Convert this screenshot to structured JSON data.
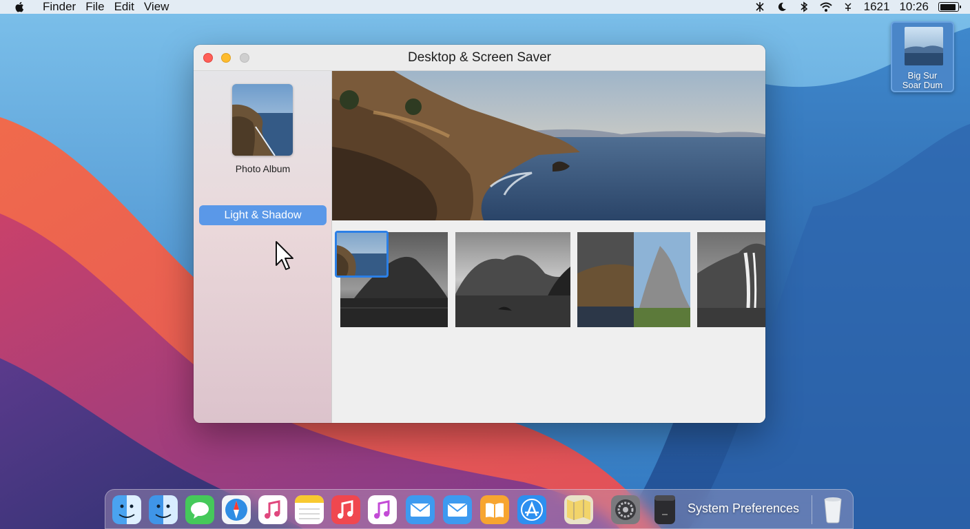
{
  "menubar": {
    "app_name": "Finder",
    "menus": [
      "File",
      "Edit",
      "View"
    ],
    "status_text_1": "1621",
    "clock": "10:26",
    "status_icons": [
      "network-icon",
      "moon-icon",
      "bluetooth-icon",
      "wifi-icon",
      "input-icon"
    ]
  },
  "desktop_widget": {
    "label": "Big Sur\nSoar Dum"
  },
  "window": {
    "title": "Desktop & Screen Saver",
    "sidebar": {
      "album_label": "Photo Album",
      "selected_item": "Light & Shadow"
    },
    "wallpaper_tiles_count": 4
  },
  "dock": {
    "hover_label": "System Preferences",
    "items": [
      "Finder",
      "Finder",
      "Messages",
      "Safari",
      "iTunes",
      "Notes",
      "Music",
      "iTunes",
      "Mail",
      "Mail",
      "Books",
      "App Store",
      "Maps",
      "System Preferences",
      "Terminal",
      "Trash"
    ]
  },
  "colors": {
    "accent": "#5a98e8",
    "selection_border": "#2b7fe6",
    "close": "#ff5f57",
    "minimize": "#febc2e"
  }
}
